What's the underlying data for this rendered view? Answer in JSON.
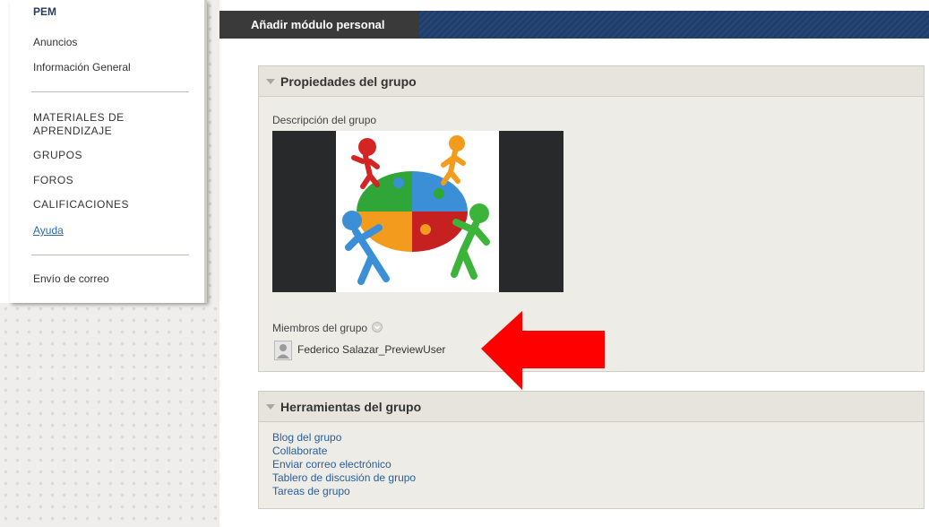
{
  "menu": {
    "title": "PEM",
    "items": [
      "Anuncios",
      "Información General"
    ],
    "sections": [
      "MATERIALES DE",
      "APRENDIZAJE",
      "GRUPOS",
      "FOROS",
      "CALIFICACIONES"
    ],
    "help": "Ayuda",
    "mail": "Envío de correo"
  },
  "banner": {
    "tab_label": "Añadir módulo personal"
  },
  "group_properties": {
    "header": "Propiedades del grupo",
    "description_label": "Descripción del grupo",
    "members_label": "Miembros del grupo",
    "member_name": "Federico Salazar_PreviewUser"
  },
  "group_tools": {
    "header": "Herramientas del grupo",
    "links": [
      "Blog del grupo",
      "Collaborate",
      "Enviar correo electrónico",
      "Tablero de discusión de grupo",
      "Tareas de grupo"
    ]
  },
  "colors": {
    "banner": "#1f3e6b",
    "arrow": "#ff0000",
    "link": "#2a5d9a"
  },
  "icons": [
    "caret-down-icon",
    "user-avatar-icon",
    "chevron-down-circle-icon",
    "red-arrow-annotation"
  ]
}
